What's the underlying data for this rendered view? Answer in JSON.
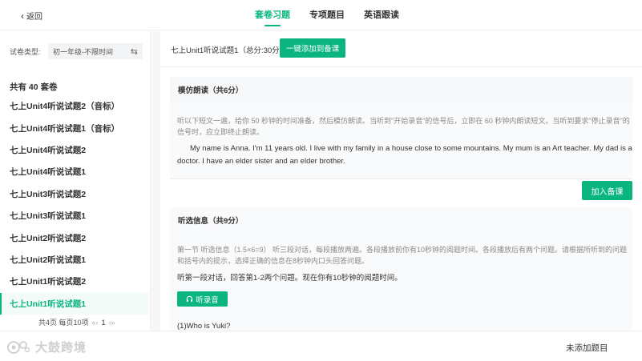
{
  "header": {
    "back_label": "返回",
    "tabs": [
      {
        "label": "套卷习题",
        "active": true
      },
      {
        "label": "专项题目",
        "active": false
      },
      {
        "label": "英语跟读",
        "active": false
      }
    ]
  },
  "sidebar": {
    "filter_label": "试卷类型:",
    "filter_value": "初一年级-不限时间",
    "count_text": "共有 40 套卷",
    "items": [
      "七上Unit4听说试题2（音标）",
      "七上Unit4听说试题1（音标）",
      "七上Unit4听说试题2",
      "七上Unit4听说试题1",
      "七上Unit3听说试题2",
      "七上Unit3听说试题1",
      "七上Unit2听说试题2",
      "七上Unit2听说试题1",
      "七上Unit1听说试题2",
      "七上Unit1听说试题1"
    ],
    "active_index": 9,
    "pager": {
      "summary": "共4页 每页10项",
      "prev": "«‹",
      "current": "1",
      "next": "›»"
    }
  },
  "main": {
    "paper_title": "七上Unit1听说试题1（总分:30分）",
    "add_all_label": "一键添加到备课",
    "section1": {
      "title": "模仿朗读（共6分）",
      "instruction": "听以下短文一遍，给你 50 秒钟的时间准备，然后模仿朗读。当听到\"开始录音\"的信号后，立即在 60 秒钟内朗读短文。当听到要求\"停止录音\"的信号时，应立即终止朗读。",
      "passage": "My name is Anna. I'm 11 years old. I live with my family in a house close to some mountains. My mum is an Art teacher. My dad is a doctor. I have an elder sister and an elder brother.",
      "add_label": "加入备课"
    },
    "section2": {
      "title": "听选信息（共9分）",
      "instruction": "第一节 听选信息（1.5×6=9） 听三段对话，每段播放两遍。各段播放前你有10秒钟的阅题时间。各段播放后有两个问题。请根据所听到的问题和括号内的提示，选择正确的信息在8秒钟内口头回答问题。",
      "intro": "听第一段对话，回答第1-2两个问题。现在你有10秒钟的阅题时间。",
      "listen_label": "听录音",
      "question": "(1)Who is Yuki?"
    }
  },
  "footer": {
    "watermark": "大鼓跨境",
    "unadded_label": "未添加题目"
  },
  "colors": {
    "accent": "#0bb580"
  }
}
